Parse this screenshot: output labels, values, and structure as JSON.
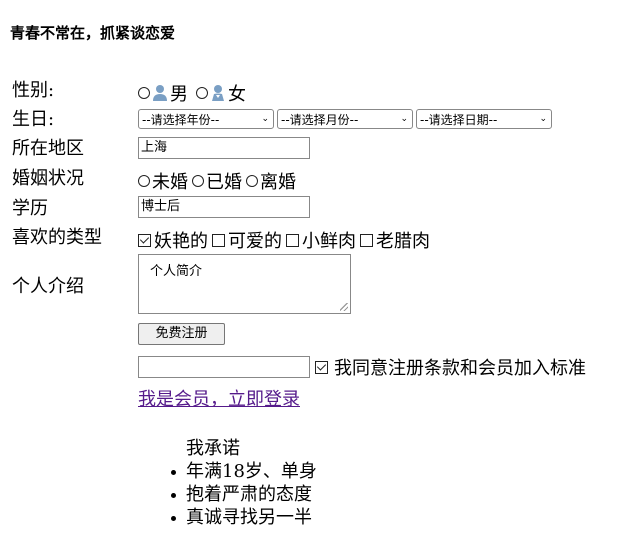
{
  "page_title": "青春不常在，抓紧谈恋爱",
  "form": {
    "gender": {
      "label": "性别:",
      "options": [
        {
          "label": "男",
          "icon": "male-user-icon",
          "checked": false
        },
        {
          "label": "女",
          "icon": "female-user-icon",
          "checked": false
        }
      ]
    },
    "birthday": {
      "label": "生日:",
      "year_placeholder": "--请选择年份--",
      "month_placeholder": "--请选择月份--",
      "day_placeholder": "--请选择日期--"
    },
    "region": {
      "label": "所在地区",
      "value": "上海"
    },
    "marital": {
      "label": "婚姻状况",
      "options": [
        {
          "label": "未婚",
          "checked": false
        },
        {
          "label": "已婚",
          "checked": false
        },
        {
          "label": "离婚",
          "checked": false
        }
      ]
    },
    "education": {
      "label": "学历",
      "value": "博士后"
    },
    "preferred_type": {
      "label": "喜欢的类型",
      "options": [
        {
          "label": "妖艳的",
          "checked": true
        },
        {
          "label": "可爱的",
          "checked": false
        },
        {
          "label": "小鲜肉",
          "checked": false
        },
        {
          "label": "老腊肉",
          "checked": false
        }
      ]
    },
    "intro": {
      "label": "个人介绍",
      "value": "个人简介"
    },
    "register_button": "免费注册",
    "agree_text": "我同意注册条款和会员加入标准",
    "agree_checked": true,
    "login_link": "我是会员，立即登录"
  },
  "promise": {
    "title": "我承诺",
    "items": [
      "年满18岁、单身",
      "抱着严肃的态度",
      "真诚寻找另一半"
    ]
  },
  "colors": {
    "link": "#551a8b",
    "icon": "#7a9fc4"
  }
}
